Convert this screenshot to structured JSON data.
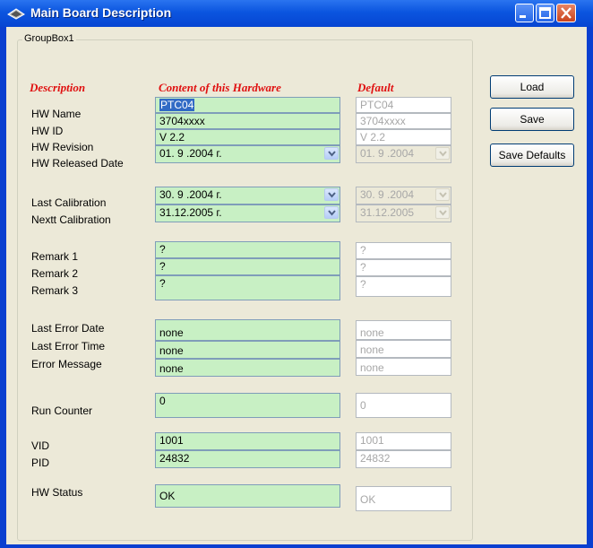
{
  "window": {
    "title": "Main Board Description"
  },
  "groupbox": {
    "title": "GroupBox1"
  },
  "headers": {
    "description": "Description",
    "content": "Content of this Hardware",
    "default": "Default"
  },
  "rows": {
    "hw_name": {
      "label": "HW Name",
      "value": "PTC04",
      "default": "PTC04"
    },
    "hw_id": {
      "label": "HW ID",
      "value": "3704xxxx",
      "default": "3704xxxx"
    },
    "hw_revision": {
      "label": "HW Revision",
      "value": "V 2.2",
      "default": "V 2.2"
    },
    "hw_released_date": {
      "label": "HW Released Date",
      "value": "01. 9 .2004 г.",
      "default": "01. 9 .2004"
    },
    "last_calibration": {
      "label": "Last Calibration",
      "value": "30. 9 .2004 г.",
      "default": "30. 9 .2004"
    },
    "next_calibration": {
      "label": "Nextt Calibration",
      "value": "31.12.2005 г.",
      "default": "31.12.2005"
    },
    "remark1": {
      "label": "Remark 1",
      "value": "?",
      "default": "?"
    },
    "remark2": {
      "label": "Remark 2",
      "value": "?",
      "default": "?"
    },
    "remark3": {
      "label": "Remark 3",
      "value": "?",
      "default": "?"
    },
    "last_error_date": {
      "label": "Last Error Date",
      "value": "none",
      "default": "none"
    },
    "last_error_time": {
      "label": "Last Error Time",
      "value": "none",
      "default": "none"
    },
    "error_message": {
      "label": "Error Message",
      "value": "none",
      "default": "none"
    },
    "run_counter": {
      "label": "Run Counter",
      "value": "0",
      "default": "0"
    },
    "vid": {
      "label": "VID",
      "value": "1001",
      "default": "1001"
    },
    "pid": {
      "label": "PID",
      "value": "24832",
      "default": "24832"
    },
    "hw_status": {
      "label": "HW Status",
      "value": "OK",
      "default": "OK"
    }
  },
  "buttons": {
    "load": "Load",
    "save": "Save",
    "save_defaults": "Save Defaults"
  },
  "icons": {
    "app": "board-icon",
    "dropdown": "chevron-down-icon"
  },
  "colors": {
    "field_bg": "#c8f0c4",
    "header_text": "#e01010",
    "titlebar": "#0b55df"
  }
}
